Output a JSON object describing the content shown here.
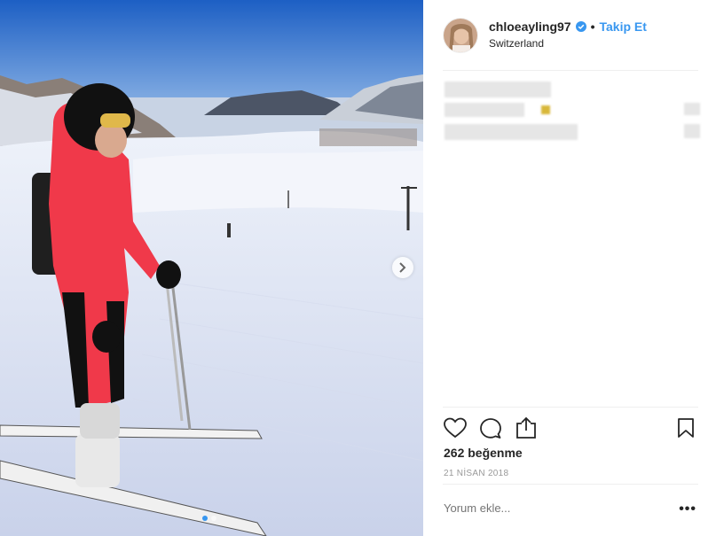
{
  "post": {
    "username": "chloeayling97",
    "separator": "•",
    "follow_label": "Takip Et",
    "location": "Switzerland",
    "likes_text": "262 beğenme",
    "date_text": "21 NİSAN 2018",
    "comment_placeholder": "Yorum ekle...",
    "more_label": "•••"
  },
  "photo": {
    "carousel_count": 2,
    "carousel_active": 1
  },
  "colors": {
    "accent": "#3897f0",
    "text": "#262626",
    "muted": "#999999",
    "divider": "#efefef"
  },
  "icons": [
    "verified-badge-icon",
    "chevron-right-icon",
    "heart-icon",
    "comment-icon",
    "share-icon",
    "bookmark-icon"
  ]
}
